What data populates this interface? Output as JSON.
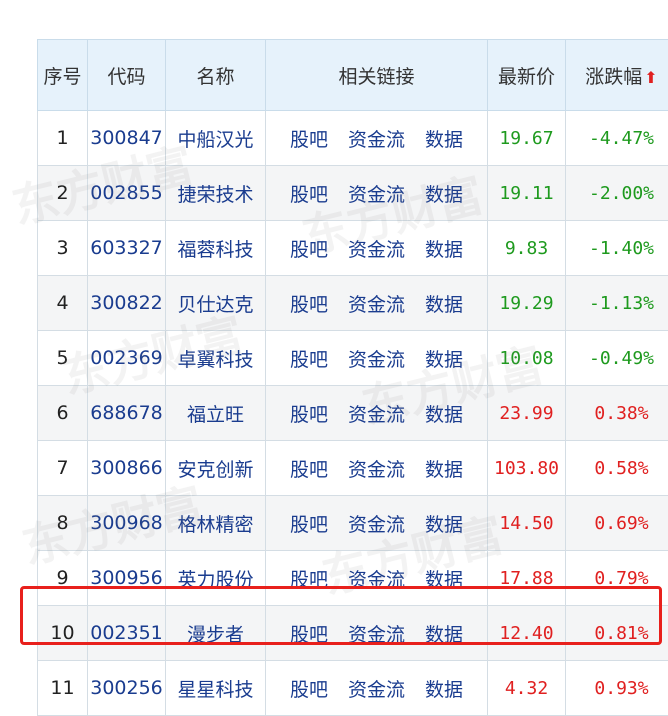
{
  "headers": {
    "seq": "序号",
    "code": "代码",
    "name": "名称",
    "links": "相关链接",
    "price": "最新价",
    "change": "涨跌幅"
  },
  "icons": {
    "sort": "sort-up-arrow-icon"
  },
  "colors": {
    "down": "#1e9a1e",
    "up": "#e02020",
    "highlight": "#e8201c"
  },
  "watermark": "东方财富",
  "rows": [
    {
      "seq": "1",
      "code": "300847",
      "name": "中船汉光",
      "links": [
        "股吧",
        "资金流",
        "数据"
      ],
      "price": "19.67",
      "change": "-4.47%",
      "dir": "down"
    },
    {
      "seq": "2",
      "code": "002855",
      "name": "捷荣技术",
      "links": [
        "股吧",
        "资金流",
        "数据"
      ],
      "price": "19.11",
      "change": "-2.00%",
      "dir": "down"
    },
    {
      "seq": "3",
      "code": "603327",
      "name": "福蓉科技",
      "links": [
        "股吧",
        "资金流",
        "数据"
      ],
      "price": "9.83",
      "change": "-1.40%",
      "dir": "down"
    },
    {
      "seq": "4",
      "code": "300822",
      "name": "贝仕达克",
      "links": [
        "股吧",
        "资金流",
        "数据"
      ],
      "price": "19.29",
      "change": "-1.13%",
      "dir": "down"
    },
    {
      "seq": "5",
      "code": "002369",
      "name": "卓翼科技",
      "links": [
        "股吧",
        "资金流",
        "数据"
      ],
      "price": "10.08",
      "change": "-0.49%",
      "dir": "down"
    },
    {
      "seq": "6",
      "code": "688678",
      "name": "福立旺",
      "links": [
        "股吧",
        "资金流",
        "数据"
      ],
      "price": "23.99",
      "change": "0.38%",
      "dir": "up"
    },
    {
      "seq": "7",
      "code": "300866",
      "name": "安克创新",
      "links": [
        "股吧",
        "资金流",
        "数据"
      ],
      "price": "103.80",
      "change": "0.58%",
      "dir": "up"
    },
    {
      "seq": "8",
      "code": "300968",
      "name": "格林精密",
      "links": [
        "股吧",
        "资金流",
        "数据"
      ],
      "price": "14.50",
      "change": "0.69%",
      "dir": "up"
    },
    {
      "seq": "9",
      "code": "300956",
      "name": "英力股份",
      "links": [
        "股吧",
        "资金流",
        "数据"
      ],
      "price": "17.88",
      "change": "0.79%",
      "dir": "up"
    },
    {
      "seq": "10",
      "code": "002351",
      "name": "漫步者",
      "links": [
        "股吧",
        "资金流",
        "数据"
      ],
      "price": "12.40",
      "change": "0.81%",
      "dir": "up",
      "highlighted": true
    },
    {
      "seq": "11",
      "code": "300256",
      "name": "星星科技",
      "links": [
        "股吧",
        "资金流",
        "数据"
      ],
      "price": "4.32",
      "change": "0.93%",
      "dir": "up"
    }
  ]
}
